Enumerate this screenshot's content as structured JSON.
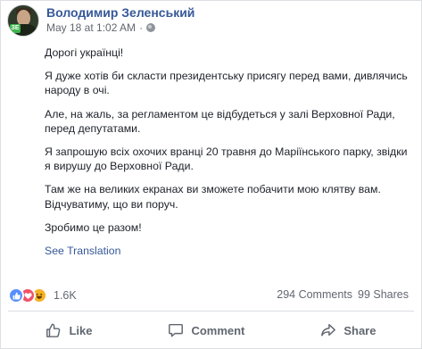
{
  "post": {
    "author": "Володимир Зеленський",
    "date": "May 18 at 1:02 AM",
    "paragraphs": [
      "Дорогі українці!",
      "Я дуже хотів би скласти президентську присягу перед вами, дивлячись народу в очі.",
      "Але, на жаль, за регламентом це відбудеться у залі Верховної Ради, перед депутатами.",
      "Я запрошую всіх охочих вранці 20 травня до Маріїнського парку, звідки я вирушу до Верховної Ради.",
      "Там же на великих екранах ви зможете побачити мою клятву вам. Відчуватиму, що ви поруч.",
      "Зробимо це разом!"
    ],
    "see_translation": "See Translation"
  },
  "engagement": {
    "reaction_icons": [
      "like-icon",
      "love-icon",
      "haha-icon"
    ],
    "reaction_count": "1.6K",
    "comments": "294 Comments",
    "shares": "99 Shares"
  },
  "actions": {
    "like": "Like",
    "comment": "Comment",
    "share": "Share"
  },
  "avatar_badge": "ЗЕ"
}
